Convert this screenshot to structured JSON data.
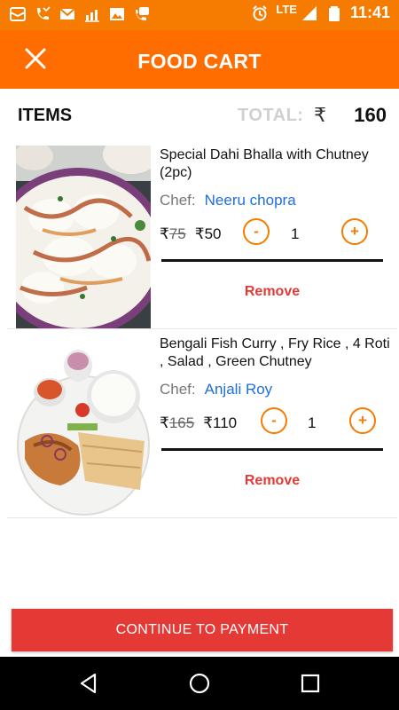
{
  "status_bar": {
    "network": "LTE",
    "time": "11:41",
    "icons": [
      "notification-app-icon",
      "missed-call-icon",
      "gmail-icon",
      "chart-icon",
      "gallery-icon",
      "call-icon",
      "alarm-icon",
      "signal-icon",
      "battery-icon"
    ]
  },
  "app_bar": {
    "title": "FOOD CART",
    "close_icon": "close-icon"
  },
  "header": {
    "items_label": "ITEMS",
    "total_label": "TOTAL:",
    "currency": "₹",
    "total_value": "160"
  },
  "items": [
    {
      "name": "Special Dahi Bhalla with Chutney (2pc)",
      "chef_label": "Chef:",
      "chef_name": "Neeru chopra",
      "currency": "₹",
      "old_price": "75",
      "new_price": "50",
      "minus": "-",
      "quantity": "1",
      "plus": "+",
      "remove": "Remove"
    },
    {
      "name": "Bengali Fish Curry , Fry Rice , 4 Roti , Salad , Green Chutney",
      "chef_label": "Chef:",
      "chef_name": "Anjali Roy",
      "currency": "₹",
      "old_price": "165",
      "new_price": "110",
      "minus": "-",
      "quantity": "1",
      "plus": "+",
      "remove": "Remove"
    }
  ],
  "continue_button": "CONTINUE TO PAYMENT",
  "nav": {
    "back": "back-icon",
    "home": "home-icon",
    "recent": "recent-apps-icon"
  },
  "colors": {
    "status_bar": "#f57c00",
    "app_bar": "#ff6d00",
    "accent_orange": "#f57c00",
    "chef_link": "#1e6fd9",
    "remove_red": "#e53935",
    "continue_red": "#e53935"
  }
}
